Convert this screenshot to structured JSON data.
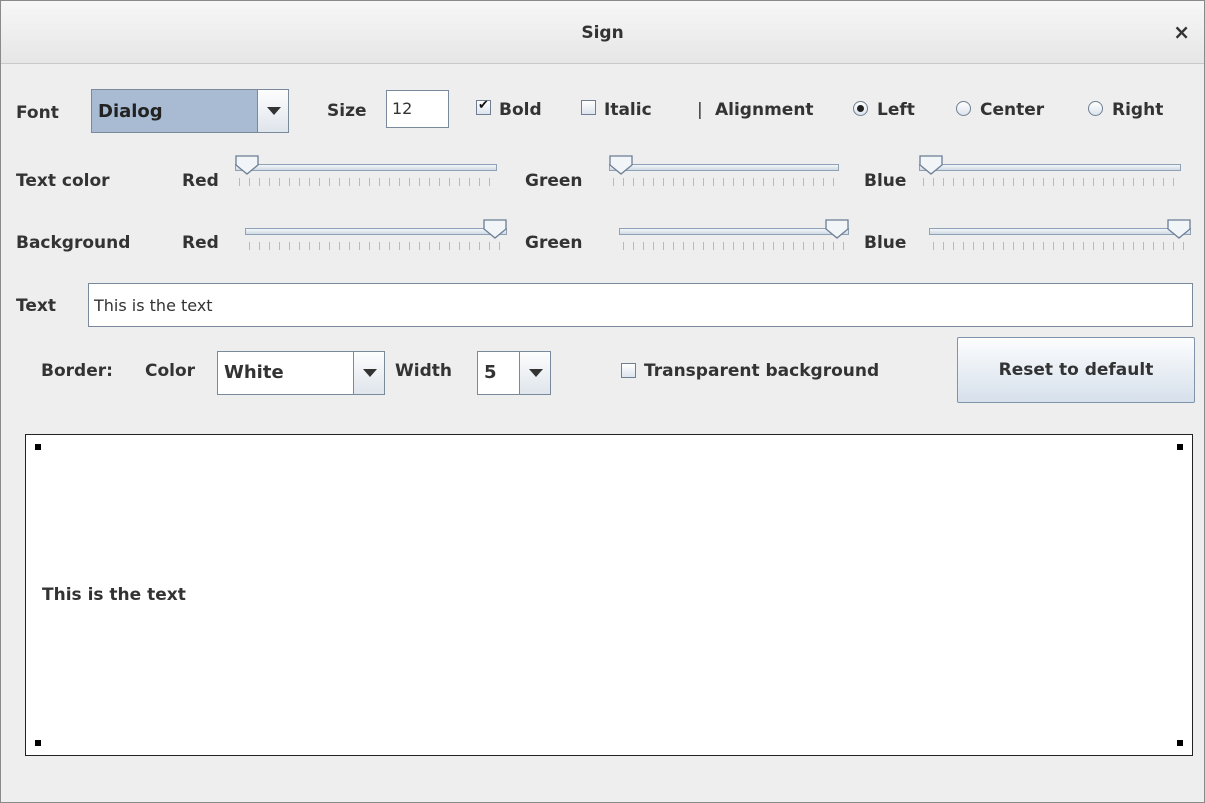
{
  "window": {
    "title": "Sign",
    "close_label": "×"
  },
  "font_row": {
    "font_label": "Font",
    "font_value": "Dialog",
    "size_label": "Size",
    "size_value": "12",
    "bold_label": "Bold",
    "bold_checked": true,
    "italic_label": "Italic",
    "italic_checked": false,
    "separator": "|",
    "alignment_label": "Alignment",
    "alignment_options": [
      "Left",
      "Center",
      "Right"
    ],
    "alignment_selected": "Left"
  },
  "text_color": {
    "label": "Text color",
    "red_label": "Red",
    "green_label": "Green",
    "blue_label": "Blue",
    "red": 0,
    "green": 0,
    "blue": 0
  },
  "background": {
    "label": "Background",
    "red_label": "Red",
    "green_label": "Green",
    "blue_label": "Blue",
    "red": 255,
    "green": 255,
    "blue": 255
  },
  "text_row": {
    "label": "Text",
    "value": "This is the text"
  },
  "border_row": {
    "border_label": "Border:",
    "color_label": "Color",
    "color_value": "White",
    "width_label": "Width",
    "width_value": "5",
    "transparent_label": "Transparent background",
    "transparent_checked": false,
    "reset_label": "Reset to default"
  },
  "preview": {
    "text": "This is the text"
  },
  "colors": {
    "combo_selected_bg": "#a8bbd3",
    "window_bg": "#eeeeee"
  },
  "icons": [
    "close-icon",
    "dropdown-arrow-icon",
    "checkmark-icon",
    "radio-dot-icon",
    "slider-thumb-icon",
    "resize-handle-icon"
  ]
}
